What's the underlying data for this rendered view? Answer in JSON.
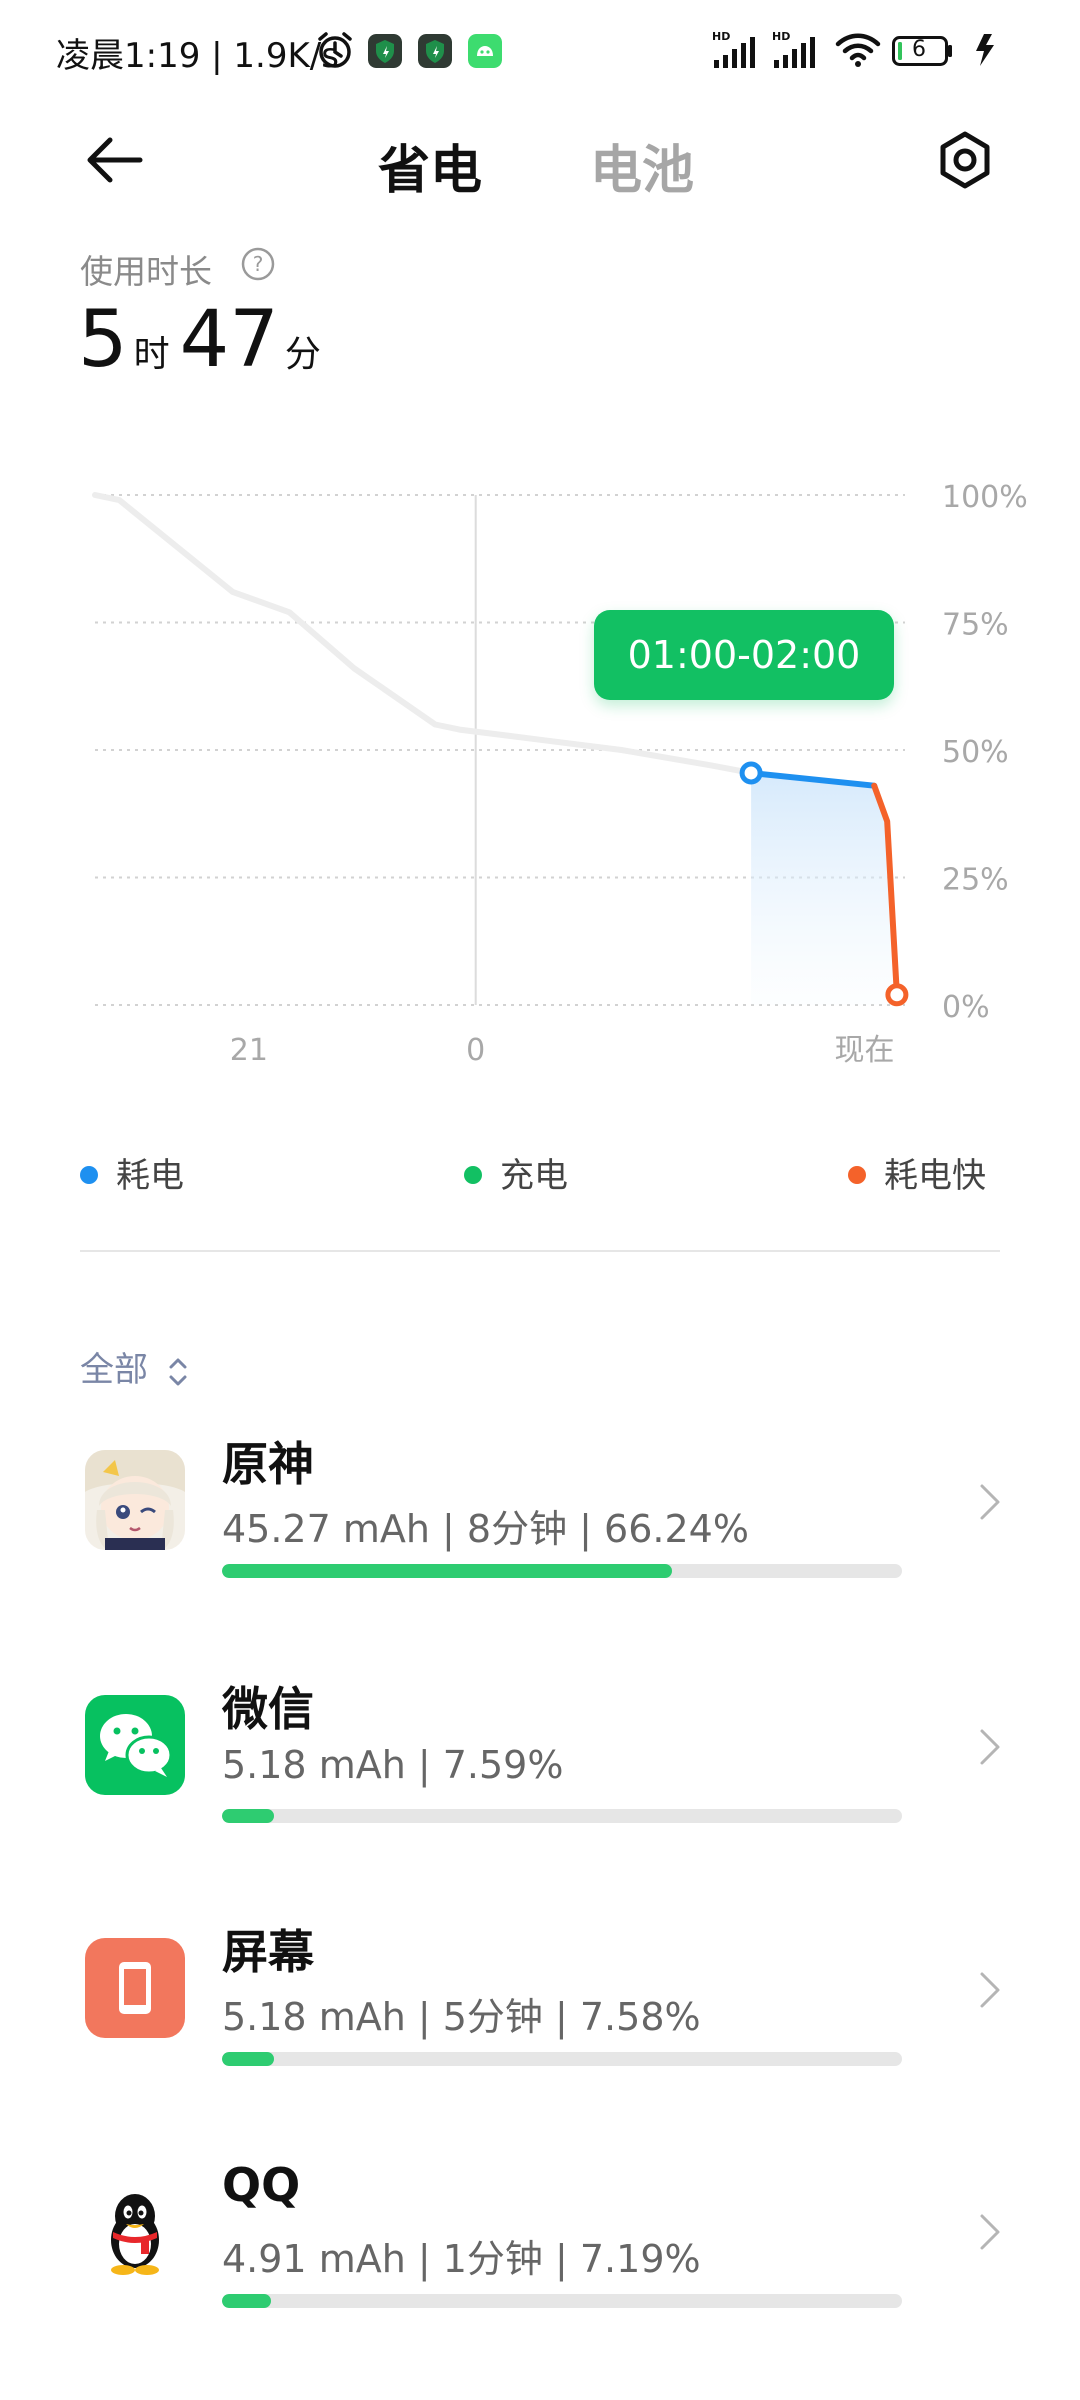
{
  "status_bar": {
    "text": "凌晨1:19 | 1.9K/s",
    "battery_level": "6",
    "icons": [
      "alarm-icon",
      "shield-app-icon",
      "shield-app-icon",
      "android-app-icon",
      "hd-signal-icon",
      "hd-signal-icon",
      "wifi-icon",
      "battery-icon",
      "charging-icon"
    ]
  },
  "header": {
    "tab_active": "省电",
    "tab_inactive": "电池"
  },
  "usage": {
    "label": "使用时长",
    "hours": "5",
    "hours_unit": "时",
    "minutes": "47",
    "minutes_unit": "分"
  },
  "chart_data": {
    "type": "line",
    "tooltip": "01:00-02:00",
    "ytick_labels": [
      "100%",
      "75%",
      "50%",
      "25%",
      "0%"
    ],
    "xtick_labels": [
      "21",
      "0",
      "现在"
    ],
    "ylim": [
      0,
      100
    ],
    "grid": true,
    "legend_position": "bottom",
    "series": [
      {
        "name": "耗电",
        "color": "#1e90f0",
        "x": [
          0.81,
          0.962
        ],
        "y": [
          45.5,
          43
        ]
      },
      {
        "name": "耗电快",
        "color": "#f4622a",
        "x": [
          0.962,
          0.978,
          0.99
        ],
        "y": [
          43,
          36,
          2
        ]
      }
    ],
    "history_series": {
      "color": "#ededed",
      "x": [
        0.0,
        0.03,
        0.17,
        0.24,
        0.32,
        0.42,
        0.45,
        0.55,
        0.65,
        0.76,
        0.81
      ],
      "y": [
        100,
        99,
        81,
        77,
        66,
        55,
        54,
        52,
        50,
        47,
        45.5
      ]
    }
  },
  "legend": [
    {
      "label": "耗电",
      "color": "#1e90f0"
    },
    {
      "label": "充电",
      "color": "#12c063"
    },
    {
      "label": "耗电快",
      "color": "#f4622a"
    }
  ],
  "filter": {
    "label": "全部"
  },
  "apps": [
    {
      "name": "原神",
      "stats": "45.27 mAh | 8分钟 | 66.24%",
      "progress": 0.6624
    },
    {
      "name": "微信",
      "stats": "5.18 mAh | 7.59%",
      "progress": 0.0759
    },
    {
      "name": "屏幕",
      "stats": "5.18 mAh | 5分钟 | 7.58%",
      "progress": 0.0758
    },
    {
      "name": "QQ",
      "stats": "4.91 mAh | 1分钟 | 7.19%",
      "progress": 0.0719
    }
  ]
}
